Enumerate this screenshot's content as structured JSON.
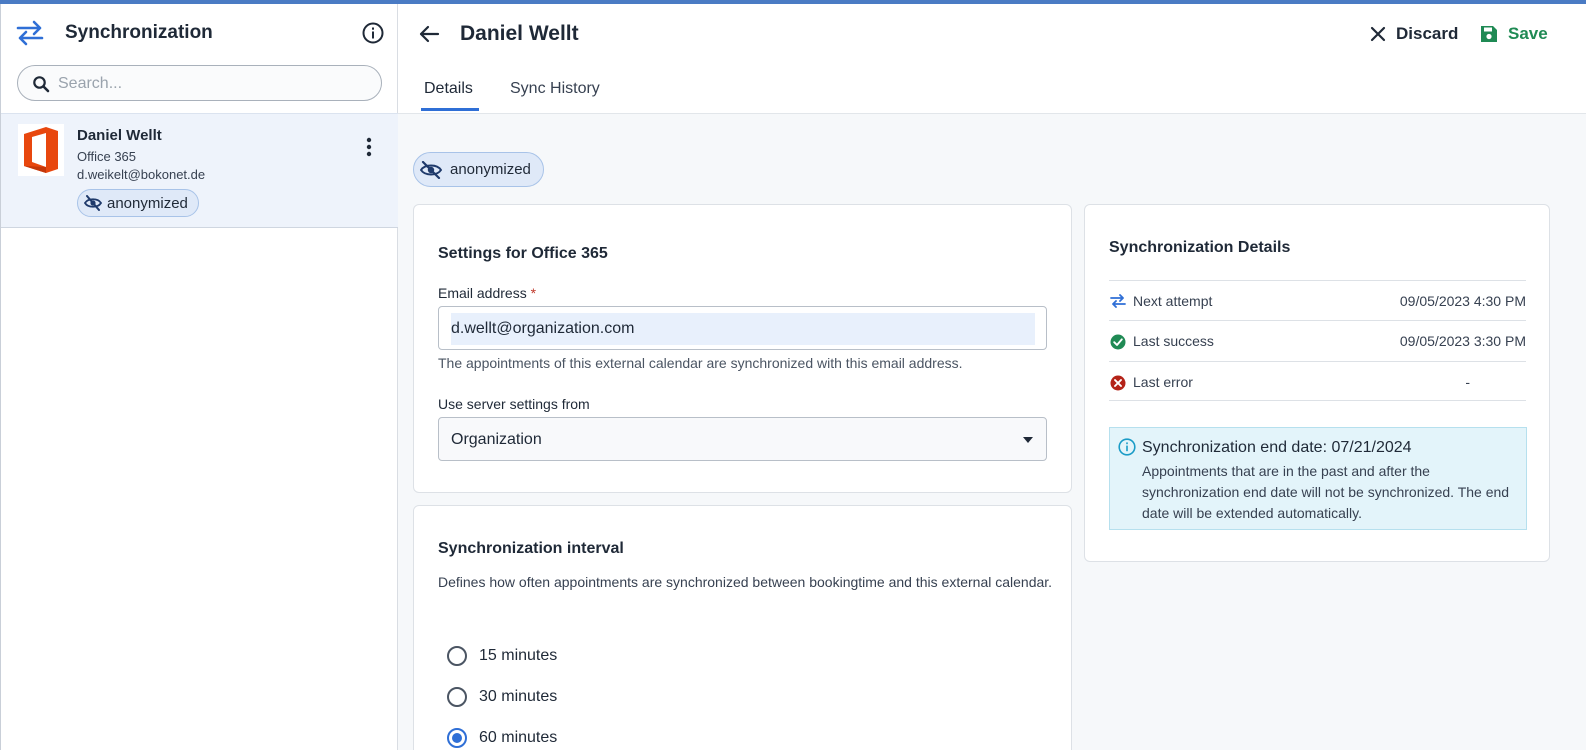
{
  "sidebar": {
    "title": "Synchronization",
    "search_placeholder": "Search...",
    "account": {
      "name": "Daniel Wellt",
      "type": "Office 365",
      "email": "d.weikelt@bokonet.de",
      "badge": "anonymized"
    }
  },
  "header": {
    "title": "Daniel Wellt",
    "discard_label": "Discard",
    "save_label": "Save",
    "tabs": [
      {
        "label": "Details",
        "active": true
      },
      {
        "label": "Sync History",
        "active": false
      }
    ]
  },
  "main": {
    "badge": "anonymized",
    "settings": {
      "title": "Settings for Office 365",
      "email_label": "Email address",
      "required_mark": "*",
      "email_value": "d.wellt@organization.com",
      "email_help": "The appointments of this external calendar are synchronized with this email address.",
      "server_label": "Use server settings from",
      "server_value": "Organization"
    },
    "interval": {
      "title": "Synchronization interval",
      "description": "Defines how often appointments are synchronized between bookingtime and this external calendar.",
      "options": [
        {
          "label": "15 minutes",
          "checked": false
        },
        {
          "label": "30 minutes",
          "checked": false
        },
        {
          "label": "60 minutes",
          "checked": true
        }
      ]
    },
    "sync_details": {
      "title": "Synchronization Details",
      "rows": [
        {
          "label": "Next attempt",
          "value": "09/05/2023 4:30 PM",
          "icon": "sync-arrows-icon"
        },
        {
          "label": "Last success",
          "value": "09/05/2023 3:30 PM",
          "icon": "success-check-icon"
        },
        {
          "label": "Last error",
          "value": "-",
          "icon": "error-x-icon"
        }
      ],
      "notice_title": "Synchronization end date: 07/21/2024",
      "notice_body": "Appointments that are in the past and after the synchronization end date will not be synchronized. The end date will be extended automatically."
    }
  },
  "colors": {
    "accent": "#2f6fd6",
    "save": "#1f8a54",
    "error": "#b42318",
    "office": "#e8470e",
    "notice_bg": "#e3f4fa"
  }
}
